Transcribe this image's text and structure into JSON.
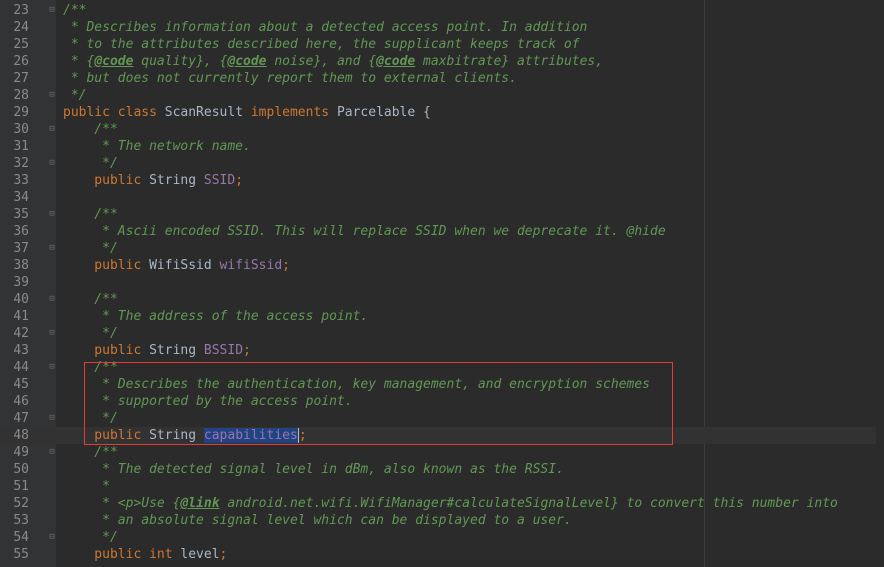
{
  "editor": {
    "language": "java",
    "current_line": "48",
    "lines": [
      {
        "n": "23",
        "fold": "⊟",
        "segments": [
          {
            "t": "/**",
            "c": "doc"
          }
        ]
      },
      {
        "n": "24",
        "fold": "",
        "segments": [
          {
            "t": " * Describes information about a detected access point. In addition",
            "c": "doc"
          }
        ]
      },
      {
        "n": "25",
        "fold": "",
        "segments": [
          {
            "t": " * to the attributes described here, the supplicant keeps track of",
            "c": "doc"
          }
        ]
      },
      {
        "n": "26",
        "fold": "",
        "segments": [
          {
            "t": " * {",
            "c": "doc"
          },
          {
            "t": "@code",
            "c": "tag"
          },
          {
            "t": " quality}, {",
            "c": "doc"
          },
          {
            "t": "@code",
            "c": "tag"
          },
          {
            "t": " noise}, and {",
            "c": "doc"
          },
          {
            "t": "@code",
            "c": "tag"
          },
          {
            "t": " maxbitrate} attributes,",
            "c": "doc"
          }
        ]
      },
      {
        "n": "27",
        "fold": "",
        "segments": [
          {
            "t": " * but does not currently report them to external clients.",
            "c": "doc"
          }
        ]
      },
      {
        "n": "28",
        "fold": "⊟",
        "segments": [
          {
            "t": " */",
            "c": "doc"
          }
        ]
      },
      {
        "n": "29",
        "fold": "",
        "segments": [
          {
            "t": "public class ",
            "c": "kw"
          },
          {
            "t": "ScanResult ",
            "c": "plain"
          },
          {
            "t": "implements ",
            "c": "kw"
          },
          {
            "t": "Parcelable {",
            "c": "plain"
          }
        ]
      },
      {
        "n": "30",
        "fold": "⊟",
        "segments": [
          {
            "t": "    /**",
            "c": "doc"
          }
        ]
      },
      {
        "n": "31",
        "fold": "",
        "segments": [
          {
            "t": "     * The network name.",
            "c": "doc"
          }
        ]
      },
      {
        "n": "32",
        "fold": "⊟",
        "segments": [
          {
            "t": "     */",
            "c": "doc"
          }
        ]
      },
      {
        "n": "33",
        "fold": "",
        "segments": [
          {
            "t": "    public ",
            "c": "kw"
          },
          {
            "t": "String ",
            "c": "plain"
          },
          {
            "t": "SSID",
            "c": "field"
          },
          {
            "t": ";",
            "c": "kw"
          }
        ]
      },
      {
        "n": "34",
        "fold": "",
        "segments": []
      },
      {
        "n": "35",
        "fold": "⊟",
        "segments": [
          {
            "t": "    /**",
            "c": "doc"
          }
        ]
      },
      {
        "n": "36",
        "fold": "",
        "segments": [
          {
            "t": "     * Ascii encoded SSID. This will replace SSID when we deprecate it. @hide",
            "c": "doc"
          }
        ]
      },
      {
        "n": "37",
        "fold": "⊟",
        "segments": [
          {
            "t": "     */",
            "c": "doc"
          }
        ]
      },
      {
        "n": "38",
        "fold": "",
        "segments": [
          {
            "t": "    public ",
            "c": "kw"
          },
          {
            "t": "WifiSsid ",
            "c": "plain"
          },
          {
            "t": "wifiSsid",
            "c": "field"
          },
          {
            "t": ";",
            "c": "kw"
          }
        ]
      },
      {
        "n": "39",
        "fold": "",
        "segments": []
      },
      {
        "n": "40",
        "fold": "⊟",
        "segments": [
          {
            "t": "    /**",
            "c": "doc"
          }
        ]
      },
      {
        "n": "41",
        "fold": "",
        "segments": [
          {
            "t": "     * The address of the access point.",
            "c": "doc"
          }
        ]
      },
      {
        "n": "42",
        "fold": "⊟",
        "segments": [
          {
            "t": "     */",
            "c": "doc"
          }
        ]
      },
      {
        "n": "43",
        "fold": "",
        "segments": [
          {
            "t": "    public ",
            "c": "kw"
          },
          {
            "t": "String ",
            "c": "plain"
          },
          {
            "t": "BSSID",
            "c": "field"
          },
          {
            "t": ";",
            "c": "kw"
          }
        ]
      },
      {
        "n": "44",
        "fold": "⊟",
        "segments": [
          {
            "t": "    /**",
            "c": "doc"
          }
        ]
      },
      {
        "n": "45",
        "fold": "",
        "segments": [
          {
            "t": "     * Describes the authentication, key management, and encryption schemes",
            "c": "doc"
          }
        ]
      },
      {
        "n": "46",
        "fold": "",
        "segments": [
          {
            "t": "     * supported by the access point.",
            "c": "doc"
          }
        ]
      },
      {
        "n": "47",
        "fold": "⊟",
        "segments": [
          {
            "t": "     */",
            "c": "doc"
          }
        ]
      },
      {
        "n": "48",
        "fold": "",
        "segments": [
          {
            "t": "    public ",
            "c": "kw"
          },
          {
            "t": "String ",
            "c": "plain"
          },
          {
            "t": "capabilities",
            "c": "sel"
          },
          {
            "t": ";",
            "c": "caret-kw"
          }
        ]
      },
      {
        "n": "49",
        "fold": "⊟",
        "segments": [
          {
            "t": "    /**",
            "c": "doc"
          }
        ]
      },
      {
        "n": "50",
        "fold": "",
        "segments": [
          {
            "t": "     * The detected signal level in dBm, also known as the RSSI.",
            "c": "doc"
          }
        ]
      },
      {
        "n": "51",
        "fold": "",
        "segments": [
          {
            "t": "     *",
            "c": "doc"
          }
        ]
      },
      {
        "n": "52",
        "fold": "",
        "segments": [
          {
            "t": "     * <p>Use {",
            "c": "doc"
          },
          {
            "t": "@link",
            "c": "tag"
          },
          {
            "t": " android.net.wifi.WifiManager#calculateSignalLevel} to convert this number into",
            "c": "doc"
          }
        ]
      },
      {
        "n": "53",
        "fold": "",
        "segments": [
          {
            "t": "     * an absolute signal level which can be displayed to a user.",
            "c": "doc"
          }
        ]
      },
      {
        "n": "54",
        "fold": "⊟",
        "segments": [
          {
            "t": "     */",
            "c": "doc"
          }
        ]
      },
      {
        "n": "55",
        "fold": "",
        "segments": [
          {
            "t": "    public ",
            "c": "kw"
          },
          {
            "t": "int ",
            "c": "kw"
          },
          {
            "t": "level",
            "c": "plain"
          },
          {
            "t": ";",
            "c": "kw"
          }
        ]
      }
    ]
  },
  "colors": {
    "background": "#2b2b2b",
    "gutter": "#313335",
    "keyword": "#cc7832",
    "doc_comment": "#629755",
    "field": "#9876aa",
    "selection": "#214283",
    "highlight_box": "#e83a3a"
  }
}
